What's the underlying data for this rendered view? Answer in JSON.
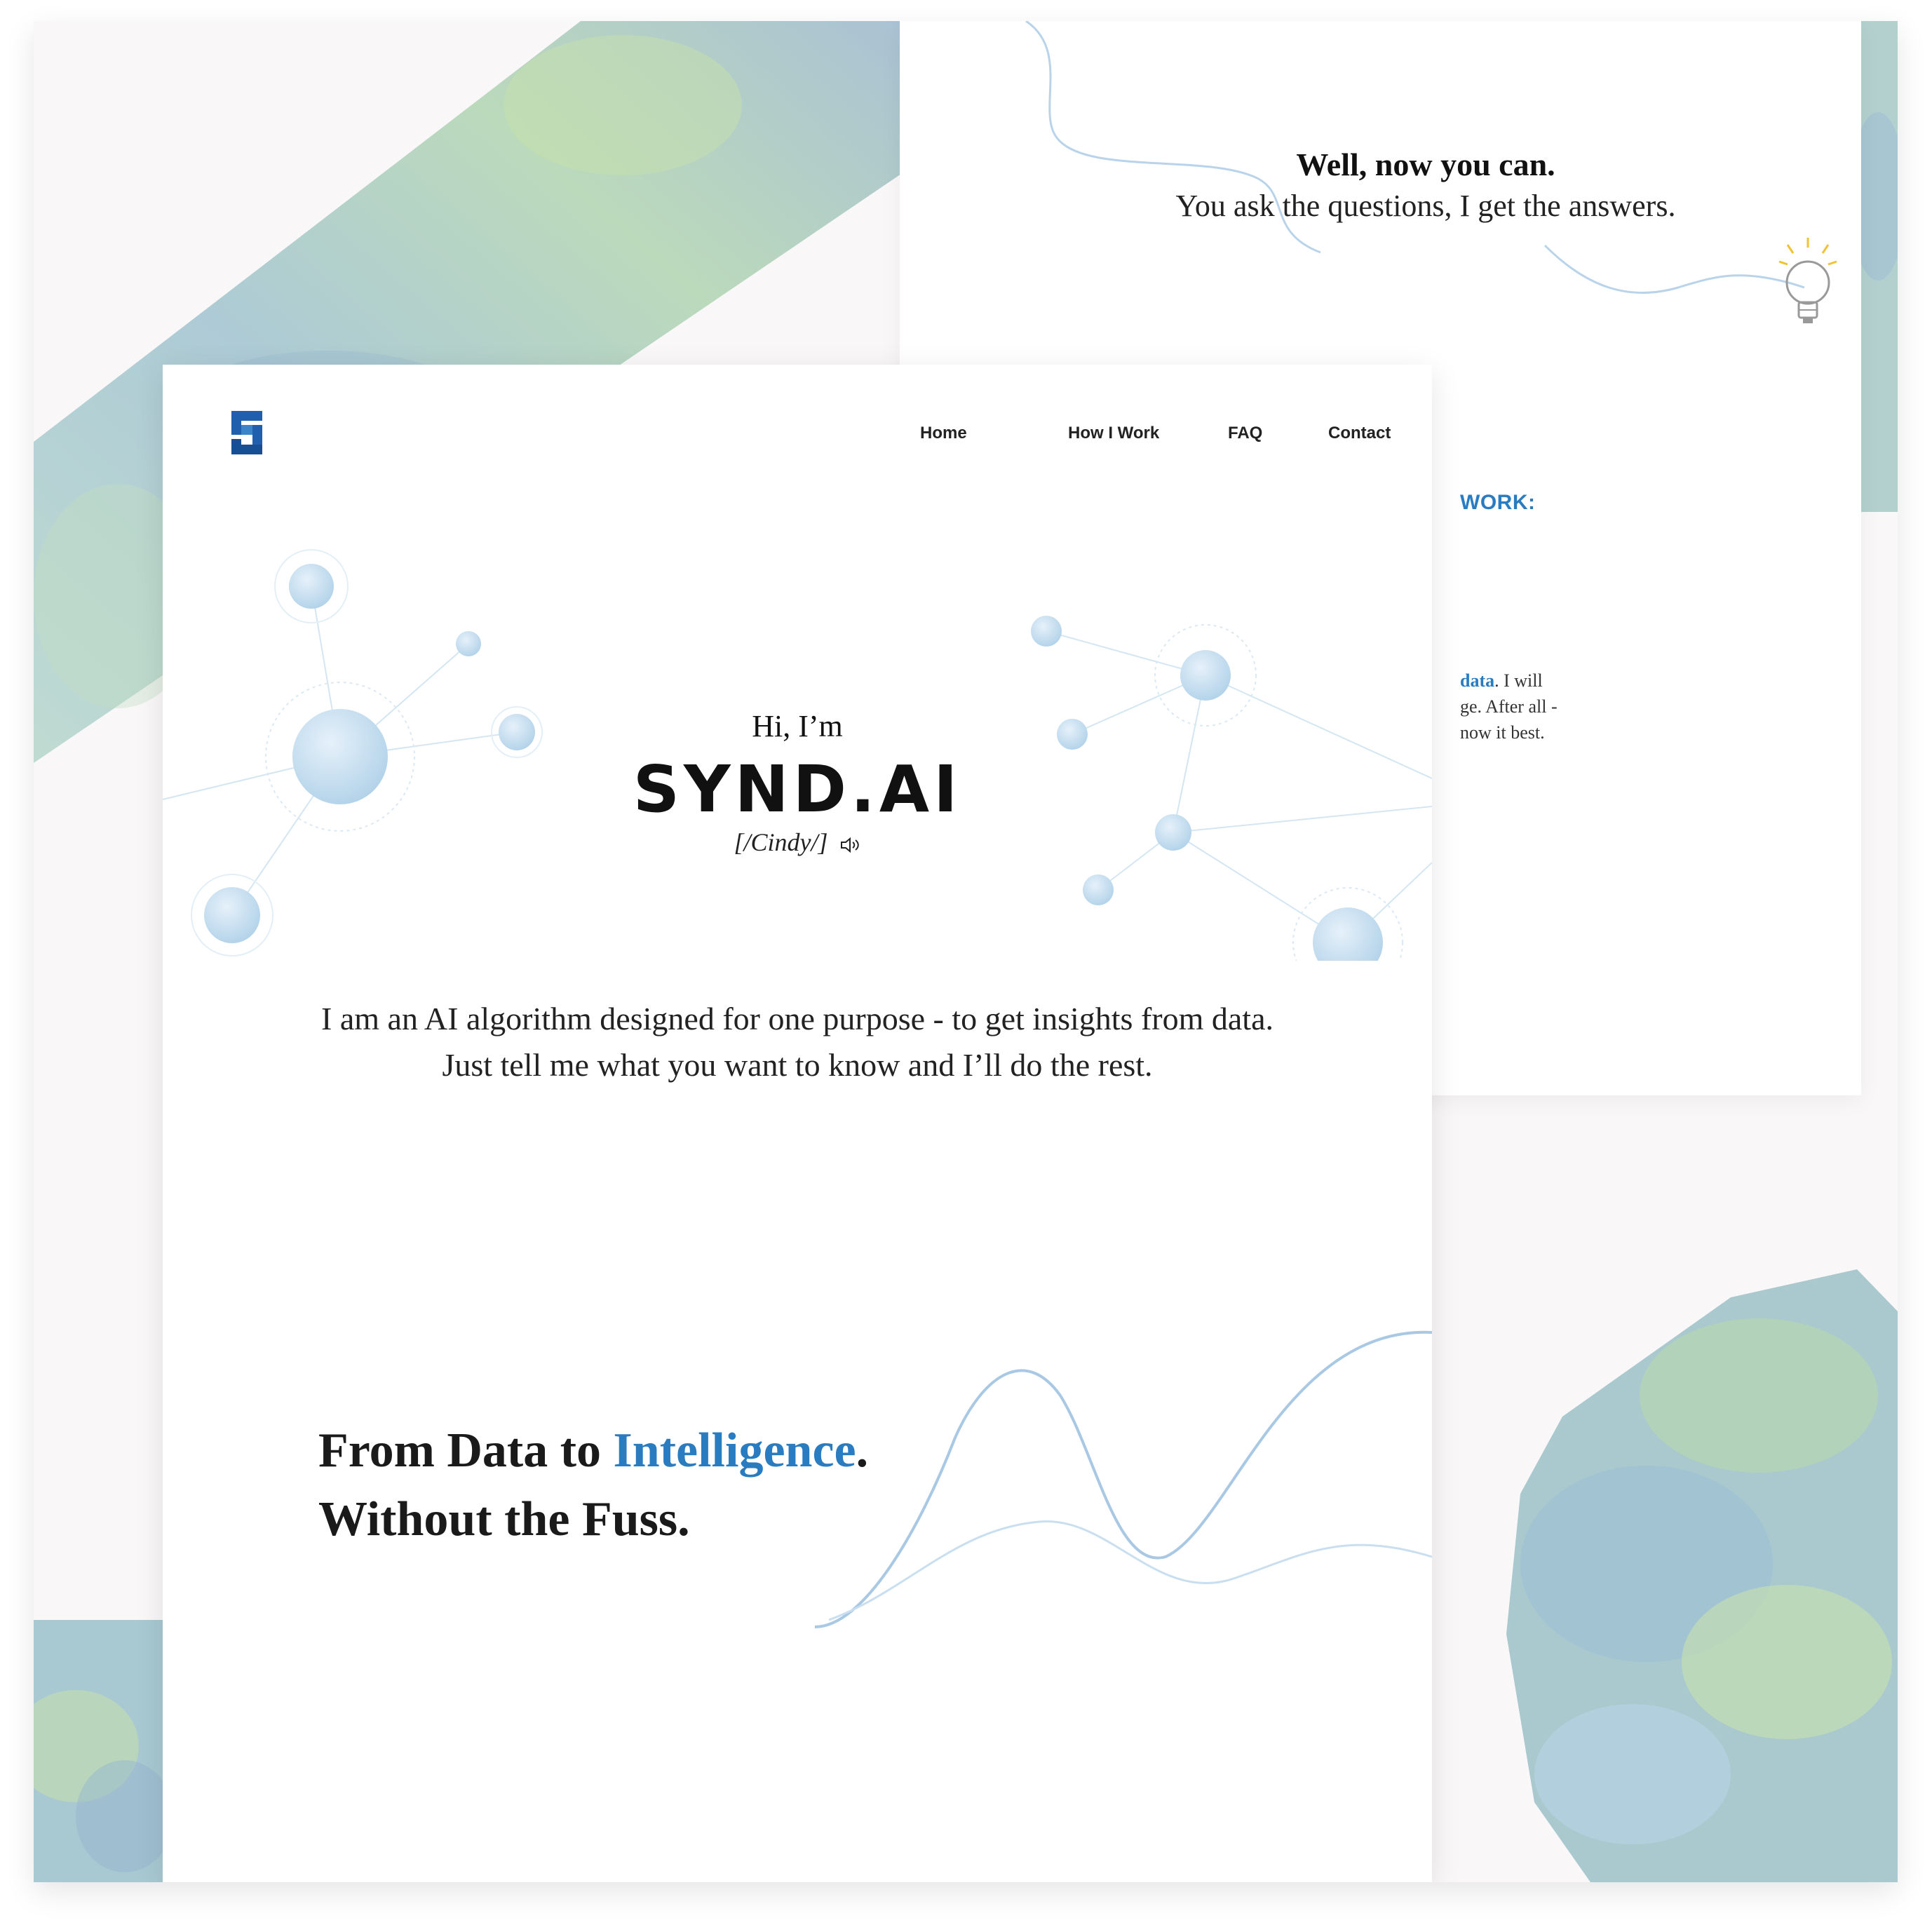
{
  "colors": {
    "accent": "#2a7cc1",
    "logo": "#1f5fae",
    "watercolor": "#9fc3cf",
    "bulb": "#f1c232"
  },
  "nav": {
    "items": [
      {
        "label": "Home"
      },
      {
        "label": "How I Work"
      },
      {
        "label": "FAQ"
      },
      {
        "label": "Contact"
      }
    ]
  },
  "hero": {
    "greeting": "Hi, I’m",
    "brand": "SYND.AI",
    "pronunciation": "[/Cindy/]",
    "intro_line1": "I am an AI algorithm designed for one purpose - to get insights from data.",
    "intro_line2": "Just tell me what you want to know and I’ll do the rest."
  },
  "tagline": {
    "part1": "From Data to ",
    "accent": "Intelligence",
    "part2": ".",
    "line2": "Without the Fuss."
  },
  "back_page": {
    "headline": "Well, now you can.",
    "subline": "You ask the questions, I get the answers.",
    "section_heading_fragment": "WORK:",
    "para_line1_link": "data",
    "para_line1_rest": ". I will",
    "para_line2": "ge. After all -",
    "para_line3": "now it best."
  },
  "icons": {
    "logo": "synd-logo-icon",
    "speaker": "speaker-icon",
    "bulb": "lightbulb-icon"
  }
}
